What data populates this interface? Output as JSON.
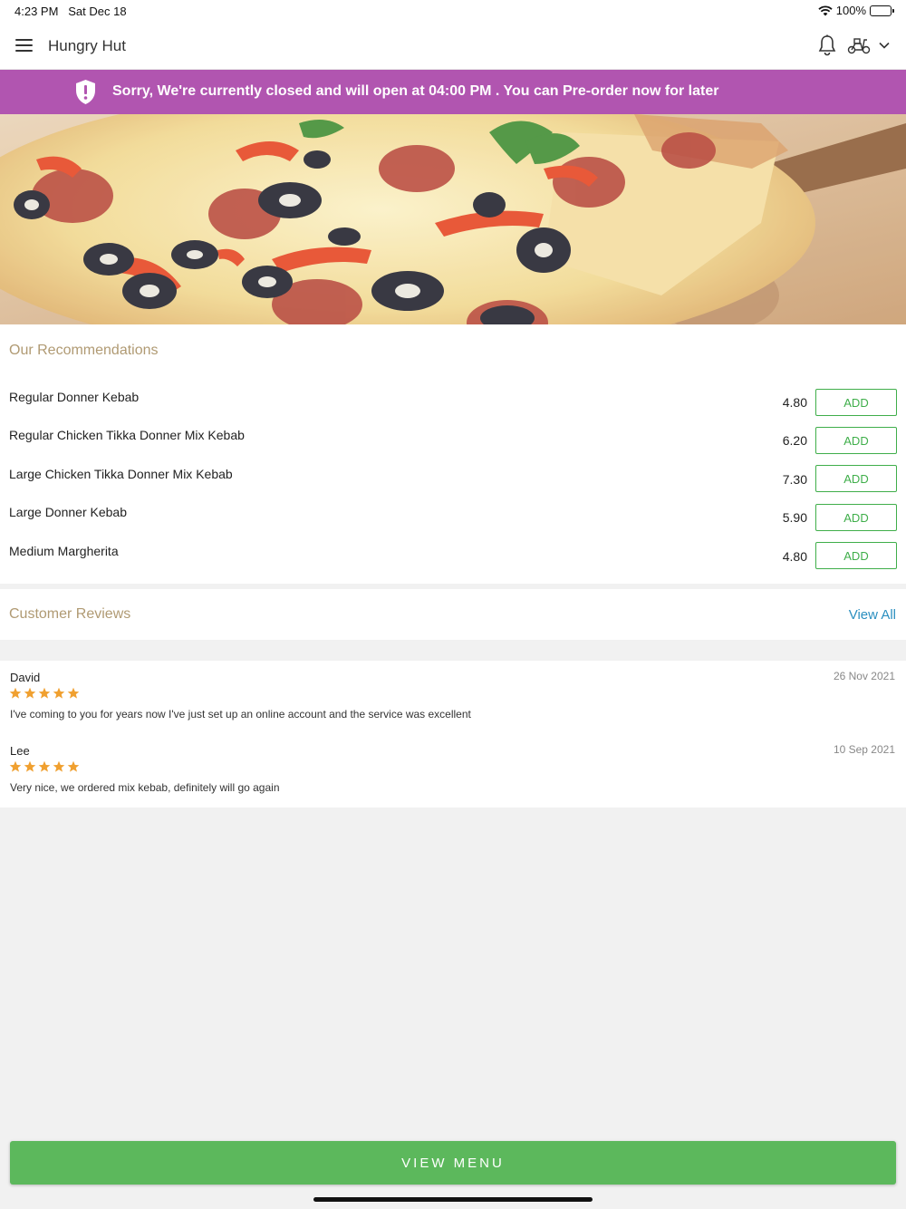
{
  "status_bar": {
    "time": "4:23 PM",
    "date": "Sat Dec 18",
    "battery": "100%"
  },
  "header": {
    "title": "Hungry Hut",
    "icons": [
      "menu-icon",
      "bell-icon",
      "scooter-icon",
      "chevron-down-icon"
    ]
  },
  "banner": {
    "text": "Sorry, We're currently closed and will open at 04:00 PM . You can Pre-order now for later",
    "color": "#b155b0",
    "icon": "shield-alert-icon"
  },
  "recommendations": {
    "title": "Our Recommendations",
    "add_label": "ADD",
    "items": [
      {
        "name": "Regular Donner Kebab",
        "price": "4.80"
      },
      {
        "name": "Regular Chicken Tikka Donner Mix Kebab",
        "price": "6.20"
      },
      {
        "name": "Large Chicken Tikka Donner Mix Kebab",
        "price": "7.30"
      },
      {
        "name": "Large Donner Kebab",
        "price": "5.90"
      },
      {
        "name": "Medium Margherita",
        "price": "4.80"
      }
    ]
  },
  "reviews": {
    "title": "Customer Reviews",
    "view_all": "View All",
    "items": [
      {
        "name": "David",
        "date": "26 Nov 2021",
        "rating": 5,
        "text": "I've coming to you for years now I've just set up an online account and the service was excellent"
      },
      {
        "name": "Lee",
        "date": "10 Sep 2021",
        "rating": 5,
        "text": "Very nice, we ordered mix kebab, definitely will go again"
      }
    ]
  },
  "footer": {
    "view_menu_label": "VIEW MENU",
    "accent": "#5cb85c"
  }
}
